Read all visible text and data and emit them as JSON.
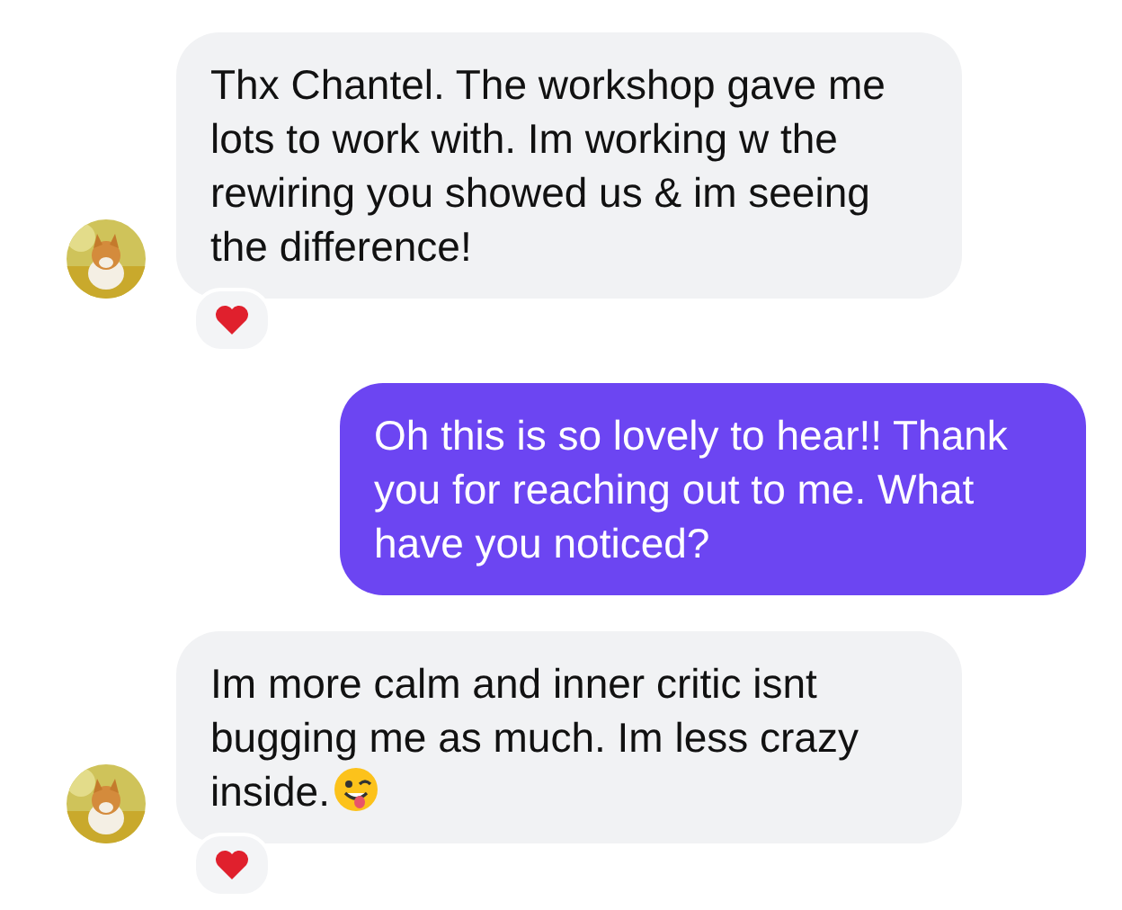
{
  "messages": [
    {
      "kind": "received",
      "text": "Thx Chantel. The workshop gave me lots to work with. Im working w the rewiring you showed us & im seeing the difference!",
      "emoji": false,
      "reaction": true
    },
    {
      "kind": "sent",
      "text": "Oh this is so lovely to hear!! Thank you for reaching out to me. What have you noticed?",
      "emoji": false,
      "reaction": false
    },
    {
      "kind": "received",
      "text": "Im more calm and inner critic isnt bugging me as much. Im less crazy inside.",
      "emoji": true,
      "reaction": true
    }
  ]
}
